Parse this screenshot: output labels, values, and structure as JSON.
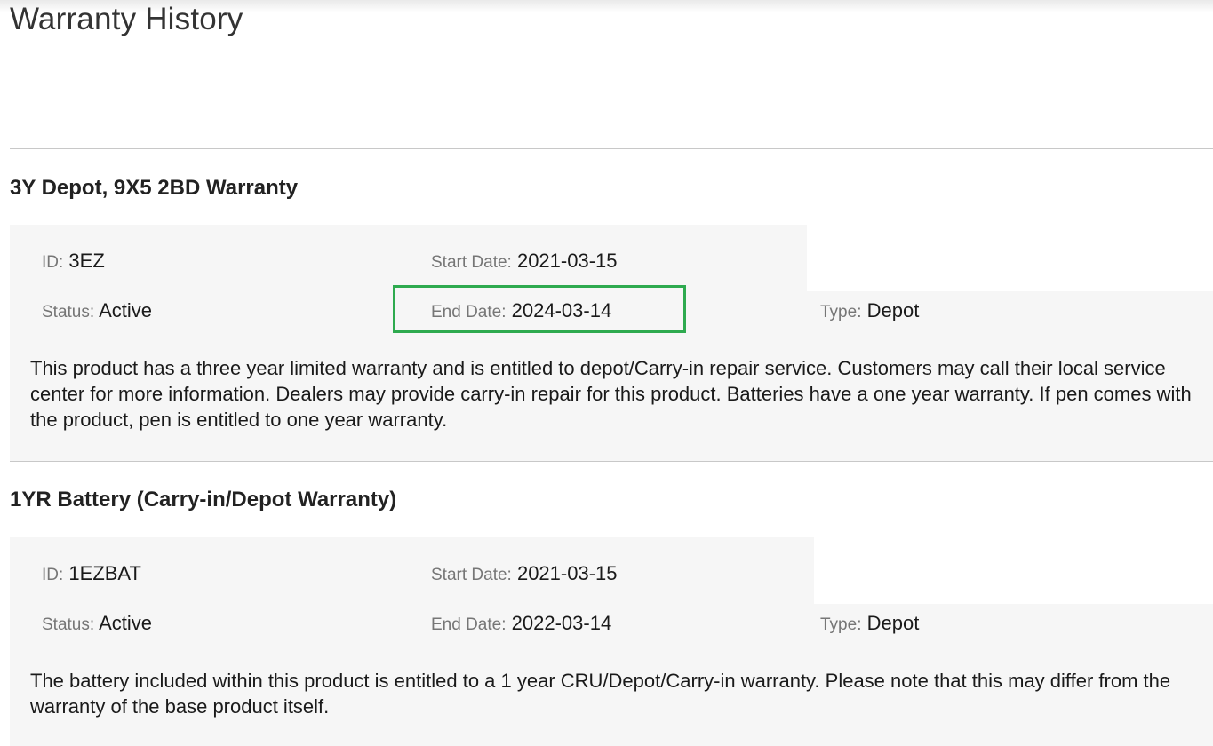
{
  "page": {
    "title": "Warranty History"
  },
  "warranties": [
    {
      "name": "3Y Depot, 9X5 2BD Warranty",
      "id_label": "ID",
      "id_value": "3EZ",
      "start_label": "Start Date",
      "start_value": "2021-03-15",
      "status_label": "Status",
      "status_value": "Active",
      "end_label": "End Date",
      "end_value": "2024-03-14",
      "type_label": "Type",
      "type_value": "Depot",
      "description": "This product has a three year limited warranty and is entitled to depot/Carry-in repair service. Customers may call their local service center for more information. Dealers may provide carry-in repair for this product. Batteries have a one year warranty. If pen comes with the product, pen is entitled to one year warranty."
    },
    {
      "name": "1YR Battery (Carry-in/Depot Warranty)",
      "id_label": "ID",
      "id_value": "1EZBAT",
      "start_label": "Start Date",
      "start_value": "2021-03-15",
      "status_label": "Status",
      "status_value": "Active",
      "end_label": "End Date",
      "end_value": "2022-03-14",
      "type_label": "Type",
      "type_value": "Depot",
      "description": "The battery included within this product is entitled to a 1 year CRU/Depot/Carry-in warranty. Please note that this may differ from the warranty of the base product itself."
    }
  ],
  "colors": {
    "highlight_border": "#2eaa4f",
    "card_background": "#f6f6f6",
    "label_gray": "#767676"
  }
}
